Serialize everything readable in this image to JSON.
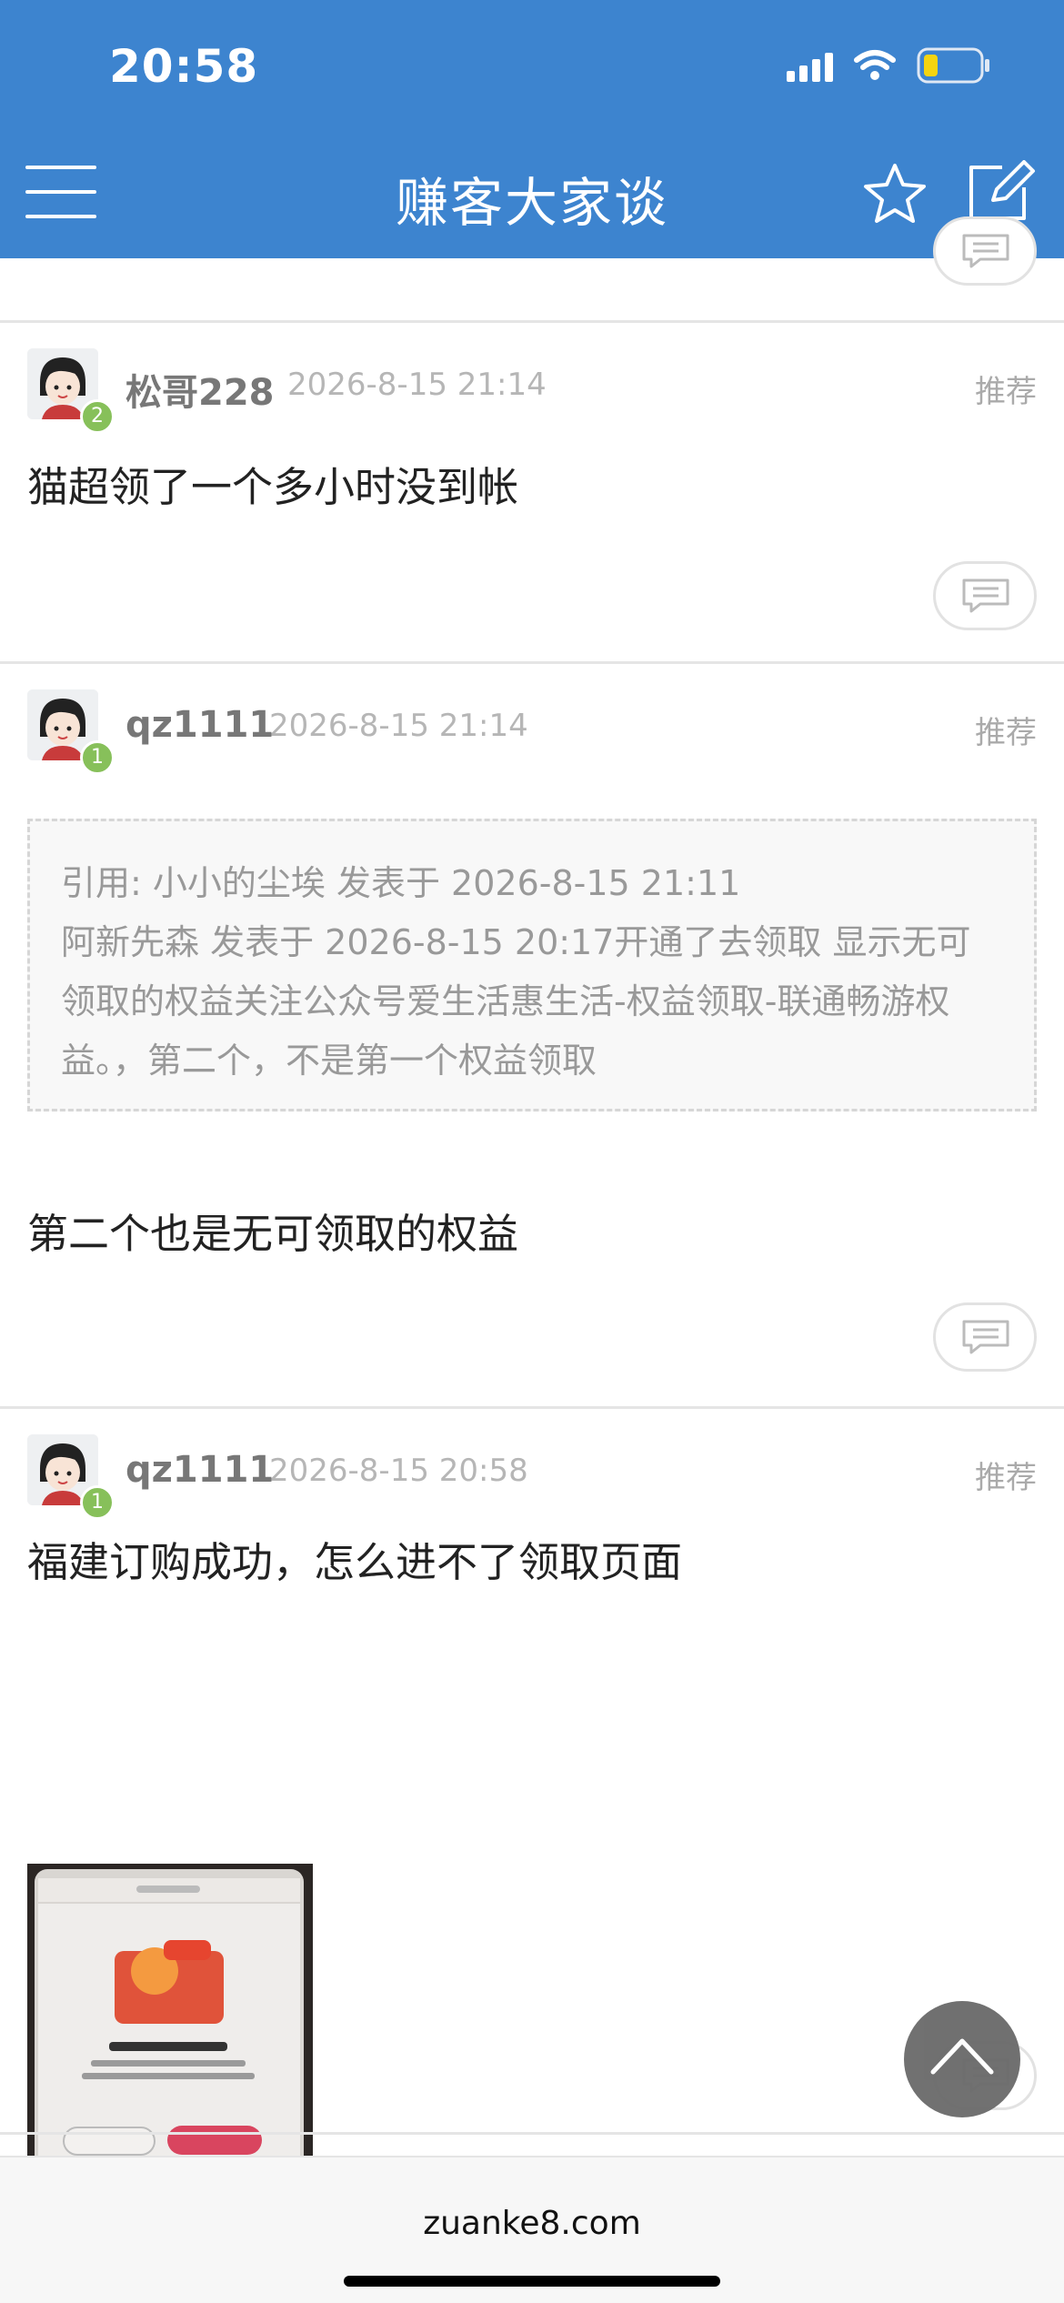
{
  "status_bar": {
    "time": "20:58"
  },
  "nav": {
    "title": "赚客大家谈"
  },
  "posts": [
    {
      "username": "松哥228",
      "timestamp": "2026-8-15 21:14",
      "level": "2",
      "recommend": "推荐",
      "content": "猫超领了一个多小时没到帐"
    },
    {
      "username": "qz1111",
      "timestamp": "2026-8-15 21:14",
      "level": "1",
      "recommend": "推荐",
      "quote_header": "引用: 小小的尘埃 发表于 2026-8-15 21:11",
      "quote_body": "阿新先森 发表于 2026-8-15 20:17开通了去领取 显示无可领取的权益关注公众号爱生活惠生活-权益领取-联通畅游权益。，第二个，不是第一个权益领取",
      "content": "第二个也是无可领取的权益"
    },
    {
      "username": "qz1111",
      "timestamp": "2026-8-15 20:58",
      "level": "1",
      "recommend": "推荐",
      "content": "福建订购成功，怎么进不了领取页面"
    }
  ],
  "footer": {
    "domain": "zuanke8.com"
  },
  "colors": {
    "header": "#3d84cf",
    "badge": "#87c05a"
  }
}
